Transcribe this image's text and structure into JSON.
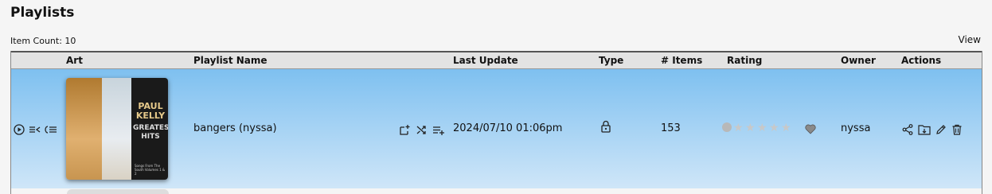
{
  "page": {
    "title": "Playlists",
    "item_count": "Item Count: 10",
    "view_label": "View"
  },
  "columns": {
    "art": "Art",
    "name": "Playlist Name",
    "last_update": "Last Update",
    "type": "Type",
    "items": "# Items",
    "rating": "Rating",
    "owner": "Owner",
    "actions": "Actions"
  },
  "rows": [
    {
      "name": "bangers (nyssa)",
      "last_update": "2024/07/10 01:06pm",
      "type_icon": "lock-icon",
      "items": "153",
      "rating": 0,
      "rating_max": 5,
      "favorite": false,
      "owner": "nyssa",
      "art": {
        "artist": "PAUL KELLY",
        "album": "GREATEST HITS",
        "subtitle": "Songs From The South Volumes 1 & 2"
      }
    }
  ],
  "colors": {
    "row_highlight_top": "#7ec0f0",
    "row_highlight_bottom": "#cfe6f8",
    "header_bg": "#e3e3e3"
  }
}
